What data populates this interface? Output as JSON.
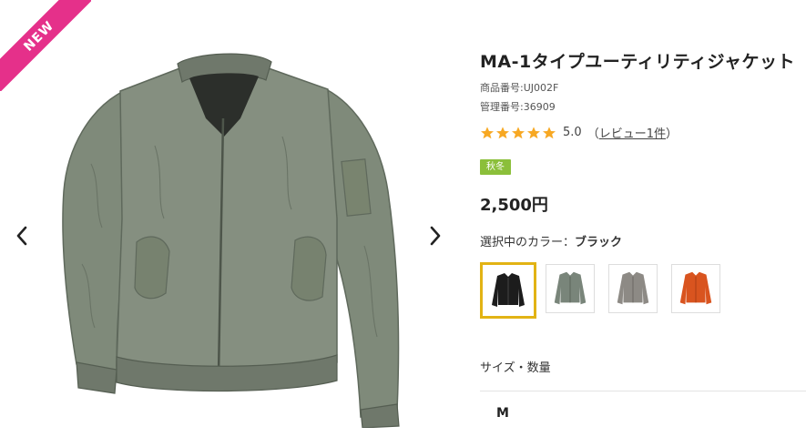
{
  "colors": {
    "ribbon": "#e5308a",
    "star": "#f7a823",
    "season_badge": "#8bbf3a",
    "selected_border": "#e2b314",
    "jacket_sage": "#7f8a7a"
  },
  "gallery": {
    "ribbon_label": "NEW",
    "prev_icon": "chevron-left-icon",
    "next_icon": "chevron-right-icon",
    "image_name": "sage-green-jacket"
  },
  "product": {
    "title": "MA-1タイプユーティリティジャケット",
    "sku": "商品番号:UJ002F",
    "mgmt_no": "管理番号:36909",
    "rating": {
      "stars": 5,
      "score": "5.0",
      "open_paren": "（",
      "review_text": "レビュー1件",
      "close_paren": "）"
    },
    "season": "秋冬",
    "price": "2,500円",
    "color_label": "選択中のカラー：",
    "color_value": "ブラック",
    "swatches": [
      {
        "name": "black",
        "color": "#1c1c1c",
        "selected": true
      },
      {
        "name": "sage",
        "color": "#79857a",
        "selected": false
      },
      {
        "name": "gray",
        "color": "#8d8a85",
        "selected": false
      },
      {
        "name": "orange",
        "color": "#d9541f",
        "selected": false
      }
    ],
    "size_label": "サイズ・数量",
    "size_option": "M"
  }
}
